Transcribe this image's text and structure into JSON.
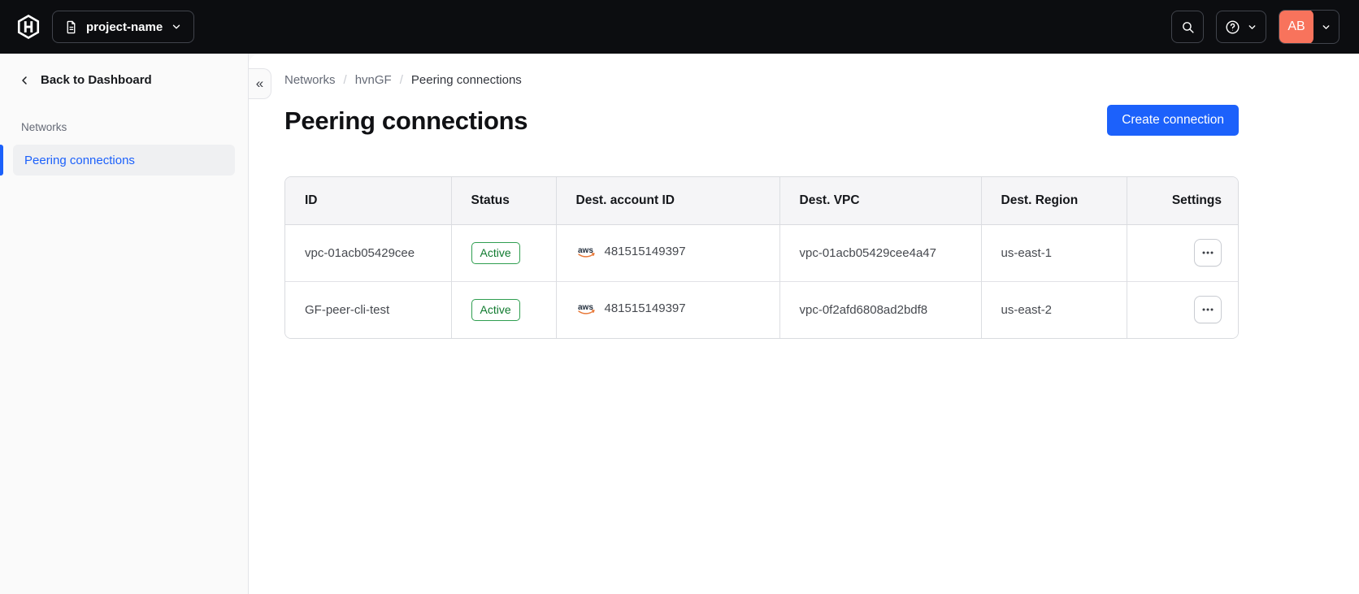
{
  "header": {
    "project_switcher_label": "project-name",
    "avatar_initials": "AB"
  },
  "sidebar": {
    "back_label": "Back to Dashboard",
    "section_title": "Networks",
    "items": [
      {
        "label": "Peering connections",
        "active": true
      }
    ]
  },
  "icons": {
    "collapse_glyph": "«",
    "aws_label": "aws"
  },
  "breadcrumb": {
    "separator": "/",
    "items": [
      "Networks",
      "hvnGF",
      "Peering connections"
    ]
  },
  "page": {
    "title": "Peering connections",
    "create_button_label": "Create connection"
  },
  "table": {
    "columns": [
      "ID",
      "Status",
      "Dest. account ID",
      "Dest. VPC",
      "Dest. Region",
      "Settings"
    ],
    "rows": [
      {
        "id": "vpc-01acb05429cee",
        "status": "Active",
        "provider_icon": "aws-icon",
        "dest_account_id": "481515149397",
        "dest_vpc": "vpc-01acb05429cee4a47",
        "dest_region": "us-east-1"
      },
      {
        "id": "GF-peer-cli-test",
        "status": "Active",
        "provider_icon": "aws-icon",
        "dest_account_id": "481515149397",
        "dest_vpc": "vpc-0f2afd6808ad2bdf8",
        "dest_region": "us-east-2"
      }
    ]
  },
  "colors": {
    "topbar_bg": "#0c0d10",
    "accent_blue": "#1c61fb",
    "status_green_text": "#0f7a2e",
    "status_green_border": "#2f9e50",
    "avatar_orange": "#f8735c",
    "aws_orange": "#e8793a",
    "sidebar_bg": "#fafafa"
  }
}
